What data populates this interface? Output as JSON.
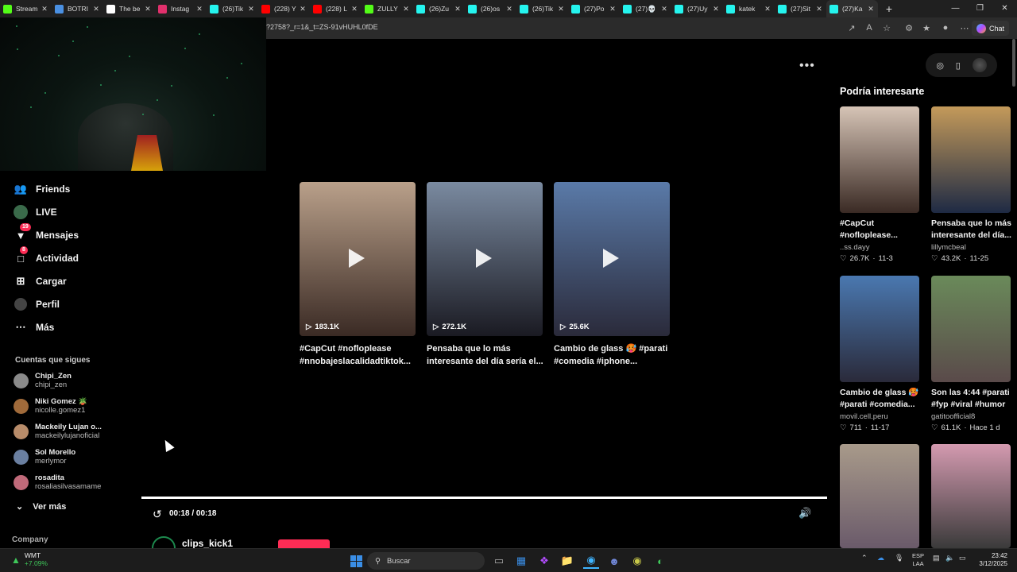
{
  "browser": {
    "tabs": [
      {
        "title": "Stream",
        "color": "#53fc18"
      },
      {
        "title": "BOTRI",
        "color": "#4a90e2"
      },
      {
        "title": "The be",
        "color": "#ffffff"
      },
      {
        "title": "Instag",
        "color": "#e1306c"
      },
      {
        "title": "(26)Tik",
        "color": "#25f4ee"
      },
      {
        "title": "(228) Y",
        "color": "#ff0000"
      },
      {
        "title": "(228) L",
        "color": "#ff0000"
      },
      {
        "title": "ZULLY",
        "color": "#53fc18"
      },
      {
        "title": "(26)Zu",
        "color": "#25f4ee"
      },
      {
        "title": "(26)os",
        "color": "#25f4ee"
      },
      {
        "title": "(26)Tik",
        "color": "#25f4ee"
      },
      {
        "title": "(27)Po",
        "color": "#25f4ee"
      },
      {
        "title": "(27)💀",
        "color": "#25f4ee"
      },
      {
        "title": "(27)Uy",
        "color": "#25f4ee"
      },
      {
        "title": "katek",
        "color": "#25f4ee"
      },
      {
        "title": "(27)Sit",
        "color": "#25f4ee"
      },
      {
        "title": "(27)Ka",
        "color": "#25f4ee"
      }
    ],
    "new_tab": "+",
    "url": "?2758?_r=1&_t=ZS-91vHUHL0fDE",
    "chat_label": "Chat"
  },
  "sidebar": {
    "nav": [
      {
        "label": "Friends",
        "icon": "friends-icon"
      },
      {
        "label": "LIVE",
        "icon": "live-icon"
      },
      {
        "label": "Mensajes",
        "icon": "messages-icon",
        "badge": "19"
      },
      {
        "label": "Actividad",
        "icon": "activity-icon",
        "badge": "8"
      },
      {
        "label": "Cargar",
        "icon": "upload-icon"
      },
      {
        "label": "Perfil",
        "icon": "profile-icon"
      },
      {
        "label": "Más",
        "icon": "more-icon"
      }
    ],
    "following_title": "Cuentas que sigues",
    "following": [
      {
        "name": "Chipi_Zen",
        "handle": "chipi_zen",
        "color": "#8a8a8a"
      },
      {
        "name": "Niki Gomez 🪴",
        "handle": "nicolle.gomez1",
        "color": "#a06a3a"
      },
      {
        "name": "Mackeily Lujan o...",
        "handle": "mackeilylujanoficial",
        "color": "#b88c6a"
      },
      {
        "name": "Sol Morello",
        "handle": "merlymor",
        "color": "#6a7fa0"
      },
      {
        "name": "rosadita",
        "handle": "rosaliasilvasamame",
        "color": "#c06a7a"
      }
    ],
    "see_more": "Ver más",
    "company": "Company"
  },
  "player": {
    "more_label": "•••",
    "time": "00:18 / 00:18",
    "progress": 1.0,
    "author": "clips_kick1"
  },
  "related": [
    {
      "caption1": "#CapCut #nofloplease",
      "caption2": "#nnobajeslacalidadtiktok...",
      "views": "183.1K",
      "color1": "#b9a08a",
      "color2": "#3a2a24"
    },
    {
      "caption1": "Pensaba que lo más",
      "caption2": "interesante del día sería el...",
      "views": "272.1K",
      "color1": "#7a8aa0",
      "color2": "#1a1a22"
    },
    {
      "caption1": "Cambio de glass 🥵 #parati",
      "caption2": "#comedia #iphone...",
      "views": "25.6K",
      "color1": "#5a7aa8",
      "color2": "#2a2a3a"
    }
  ],
  "right_rail": {
    "title": "Podría interesarte",
    "items": [
      {
        "cap1": "#CapCut",
        "cap2": "#nofloplease...",
        "author": "..ss.dayy",
        "likes": "26.7K",
        "date": "11-3",
        "color1": "#d6c4b6",
        "color2": "#3a2a24"
      },
      {
        "cap1": "Pensaba que lo más",
        "cap2": "interesante del día...",
        "author": "lillymcbeal",
        "likes": "43.2K",
        "date": "11-25",
        "color1": "#c49a5a",
        "color2": "#1e2a44"
      },
      {
        "cap1": "Cambio de glass 🥵",
        "cap2": "#parati #comedia...",
        "author": "movil.cell.peru",
        "likes": "711",
        "date": "11-17",
        "color1": "#4a78b0",
        "color2": "#2a2a3a"
      },
      {
        "cap1": "Son las 4:44 #parati",
        "cap2": "#fyp #viral #humor",
        "author": "gatitoofficial8",
        "likes": "61.1K",
        "date": "Hace 1 d",
        "color1": "#6a8a5a",
        "color2": "#5a4a4a"
      },
      {
        "cap1": "",
        "cap2": "",
        "author": "",
        "likes": "",
        "date": "",
        "color1": "#a89a8a",
        "color2": "#6a5a6a"
      },
      {
        "cap1": "",
        "cap2": "",
        "author": "",
        "likes": "",
        "date": "",
        "color1": "#d49ab0",
        "color2": "#3a3a3a"
      }
    ]
  },
  "taskbar": {
    "stock_name": "WMT",
    "stock_change": "+7.09%",
    "search_placeholder": "Buscar",
    "lang1": "ESP",
    "lang2": "LAA",
    "time": "23:42",
    "date": "3/12/2025"
  }
}
